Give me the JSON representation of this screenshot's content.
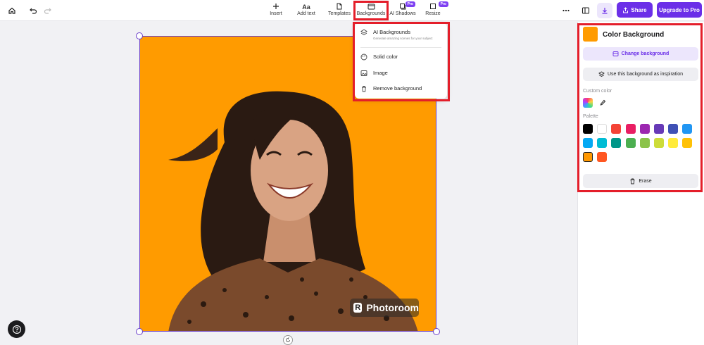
{
  "toolbar": {
    "insert": "Insert",
    "add_text": "Add text",
    "add_text_glyph": "Aa",
    "templates": "Templates",
    "backgrounds": "Backgrounds",
    "ai_shadows": "AI Shadows",
    "resize": "Resize",
    "pro_badge": "Pro",
    "share": "Share",
    "upgrade": "Upgrade to Pro"
  },
  "dropdown": {
    "ai_backgrounds": "AI Backgrounds",
    "ai_backgrounds_sub": "Generate amazing scenes for your subject",
    "solid_color": "Solid color",
    "image": "Image",
    "remove_background": "Remove background"
  },
  "canvas": {
    "background_color": "#ff9b00",
    "watermark": "Photoroom"
  },
  "panel": {
    "title": "Color Background",
    "change_background": "Change background",
    "use_inspiration": "Use this background as inspiration",
    "custom_color_label": "Custom color",
    "palette_label": "Palette",
    "erase": "Erase",
    "palette": [
      "#000000",
      "#ffffff",
      "#f44336",
      "#e91e63",
      "#9c27b0",
      "#673ab7",
      "#3f51b5",
      "#2196f3",
      "#03a9f4",
      "#00bcd4",
      "#009688",
      "#4caf50",
      "#8bc34a",
      "#cddc39",
      "#ffeb3b",
      "#ffc107",
      "#ff9800",
      "#ff5722"
    ],
    "selected_color": "#ff9800"
  },
  "colors": {
    "accent": "#6b2fe8",
    "highlight": "#e41e2a"
  }
}
